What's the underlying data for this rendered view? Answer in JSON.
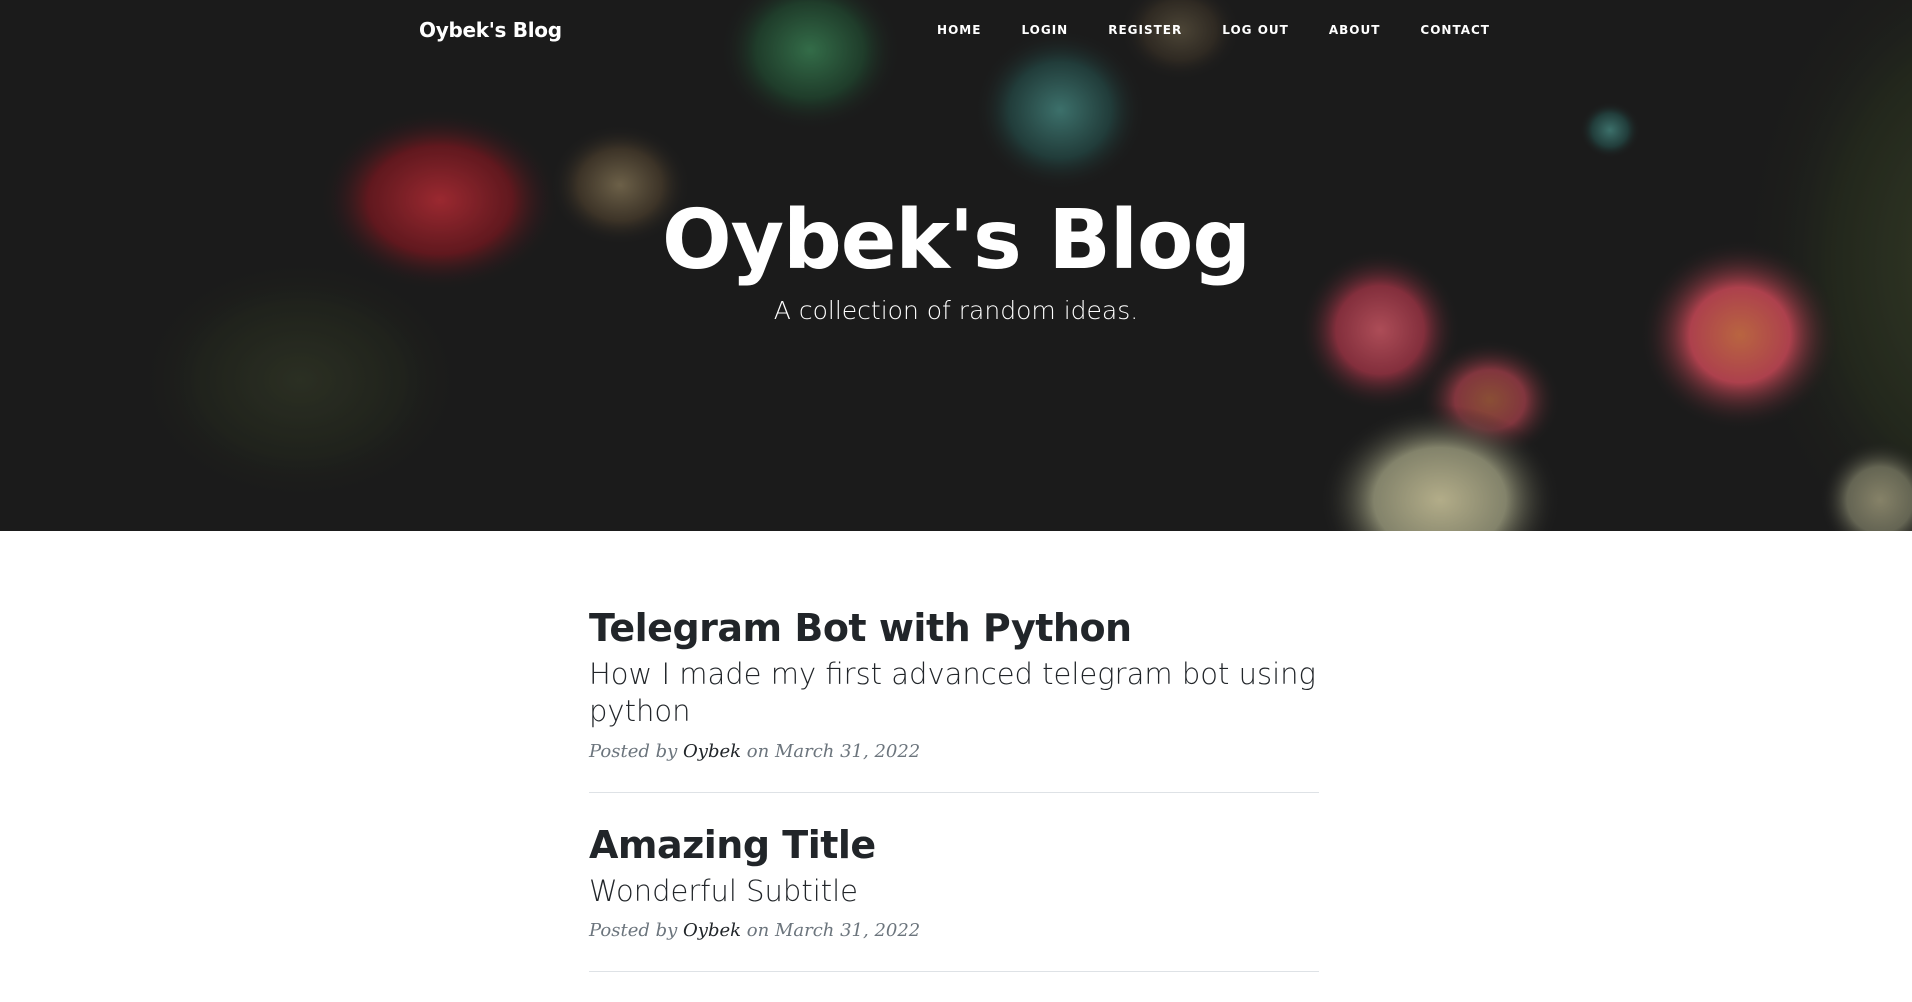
{
  "navbar": {
    "brand": "Oybek's Blog",
    "links": [
      "HOME",
      "LOGIN",
      "REGISTER",
      "LOG OUT",
      "ABOUT",
      "CONTACT"
    ]
  },
  "header": {
    "title": "Oybek's Blog",
    "subtitle": "A collection of random ideas."
  },
  "posts": [
    {
      "title": "Telegram Bot with Python",
      "subtitle": "How I made my first advanced telegram bot using python",
      "meta_prefix": "Posted by",
      "author": "Oybek",
      "meta_on": "on",
      "date": "March 31, 2022"
    },
    {
      "title": "Amazing Title",
      "subtitle": "Wonderful Subtitle",
      "meta_prefix": "Posted by",
      "author": "Oybek",
      "meta_on": "on",
      "date": "March 31, 2022"
    }
  ],
  "colors": {
    "heading_text": "#212529",
    "meta_text": "#6c757d",
    "divider": "#dee2e6",
    "header_background": "#1e1e1e"
  }
}
